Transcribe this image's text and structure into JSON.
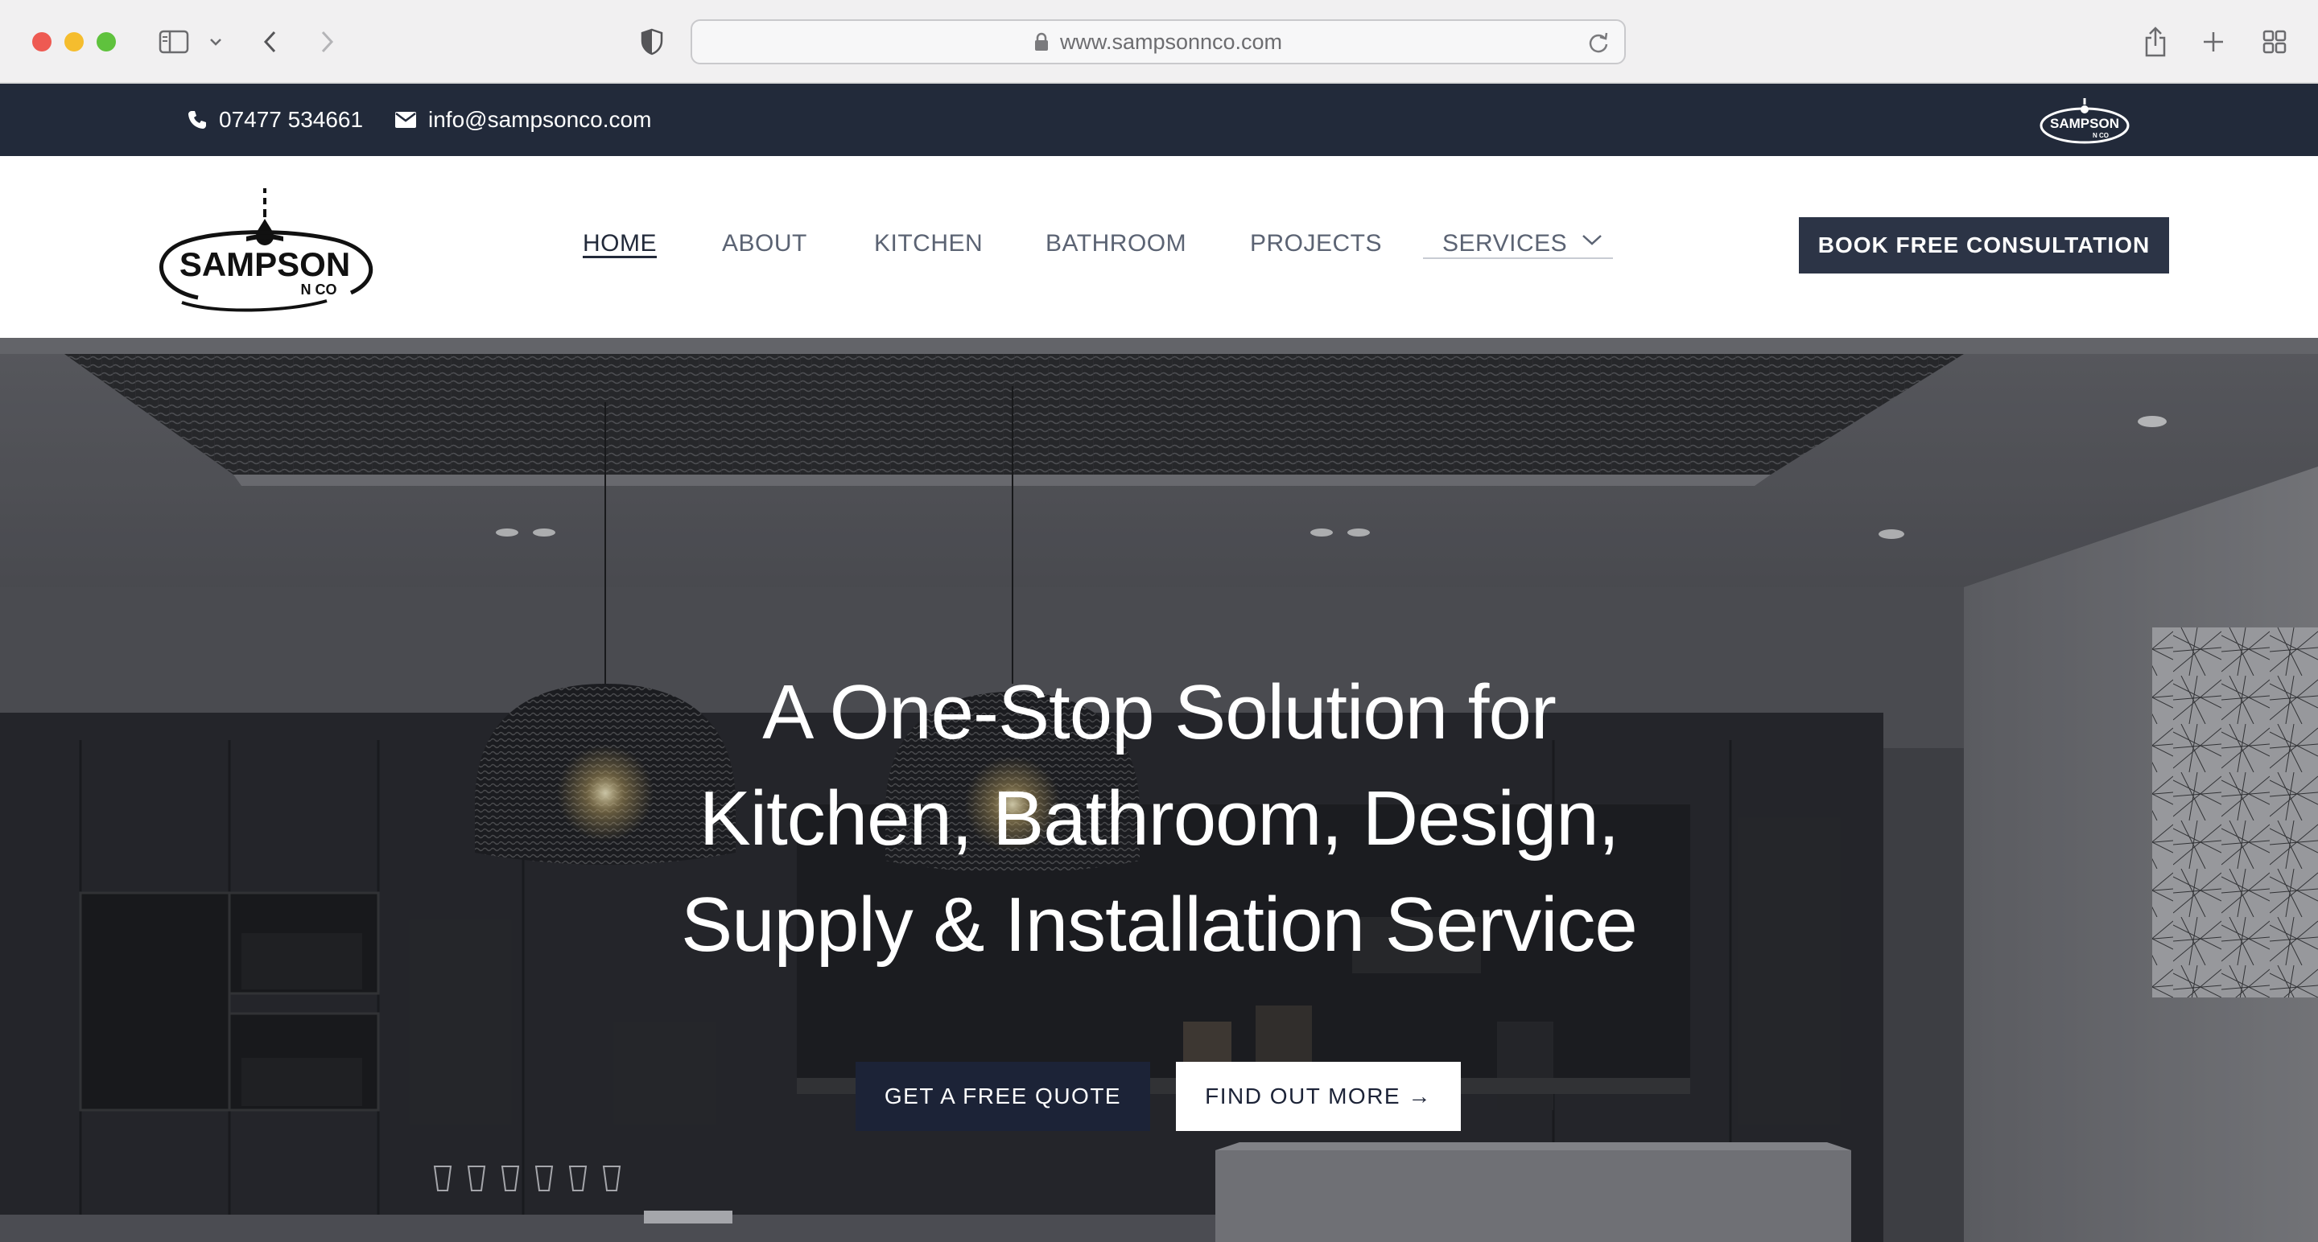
{
  "browser": {
    "url": "www.sampsonnco.com",
    "icons": [
      "sidebar-toggle-icon",
      "chevron-down-icon",
      "back-icon",
      "forward-icon",
      "privacy-shield-icon",
      "lock-icon",
      "reload-icon",
      "share-icon",
      "new-tab-icon",
      "tab-overview-icon"
    ]
  },
  "topbar": {
    "phone": "07477 534661",
    "email": "info@sampsonco.com",
    "logo_text": "SAMPSON",
    "logo_sub": "N CO"
  },
  "header": {
    "logo_text": "SAMPSON",
    "logo_sub": "N CO",
    "nav": {
      "home": "HOME",
      "about": "ABOUT",
      "kitchen": "KITCHEN",
      "bathroom": "BATHROOM",
      "projects": "PROJECTS",
      "services": "SERVICES"
    },
    "cta": "BOOK FREE CONSULTATION"
  },
  "hero": {
    "title_line1": "A One-Stop Solution for",
    "title_line2": "Kitchen, Bathroom, Design,",
    "title_line3": "Supply & Installation Service",
    "primary_button": "GET A FREE QUOTE",
    "secondary_button": "FIND OUT MORE →"
  },
  "colors": {
    "navy": "#222a3a",
    "button_dark": "#1c2337",
    "white": "#ffffff"
  }
}
